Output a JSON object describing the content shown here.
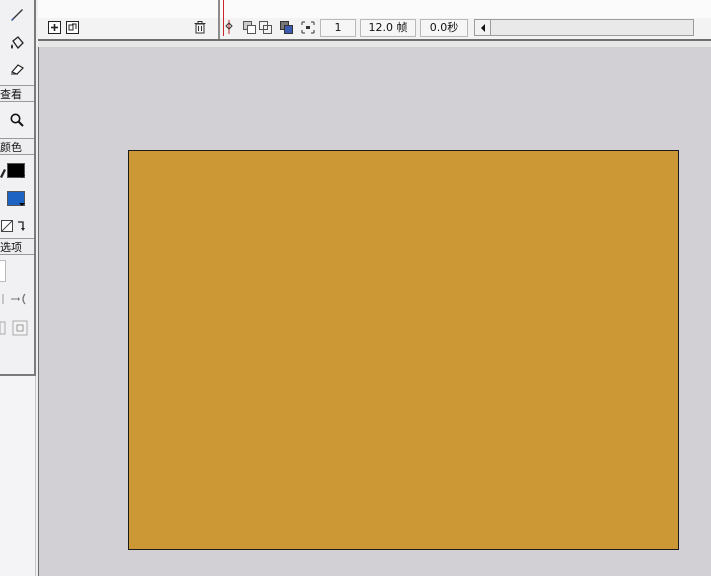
{
  "tools": {
    "section_view": "查看",
    "section_colors": "颜色",
    "section_options": "选项",
    "icons": [
      "brush-icon",
      "paint-bucket-icon",
      "eraser-icon",
      "zoom-icon",
      "no-color-icon",
      "swap-colors-icon",
      "smooth-icon",
      "straighten-icon"
    ],
    "stroke_color": "#000000",
    "fill_color": "#1c63c4"
  },
  "timeline": {
    "current_frame": "1",
    "frame_rate": "12.0 帧",
    "elapsed_time": "0.0秒",
    "icons": [
      "insert-layer-icon",
      "insert-folder-icon",
      "delete-layer-icon",
      "center-frame-icon",
      "onion-skin-icon",
      "onion-skin-outlines-icon",
      "edit-multiple-frames-icon",
      "modify-markers-icon",
      "scroll-left-icon"
    ]
  },
  "stage": {
    "background_color": "#d3d0d5",
    "canvas_color": "#cb9835"
  }
}
